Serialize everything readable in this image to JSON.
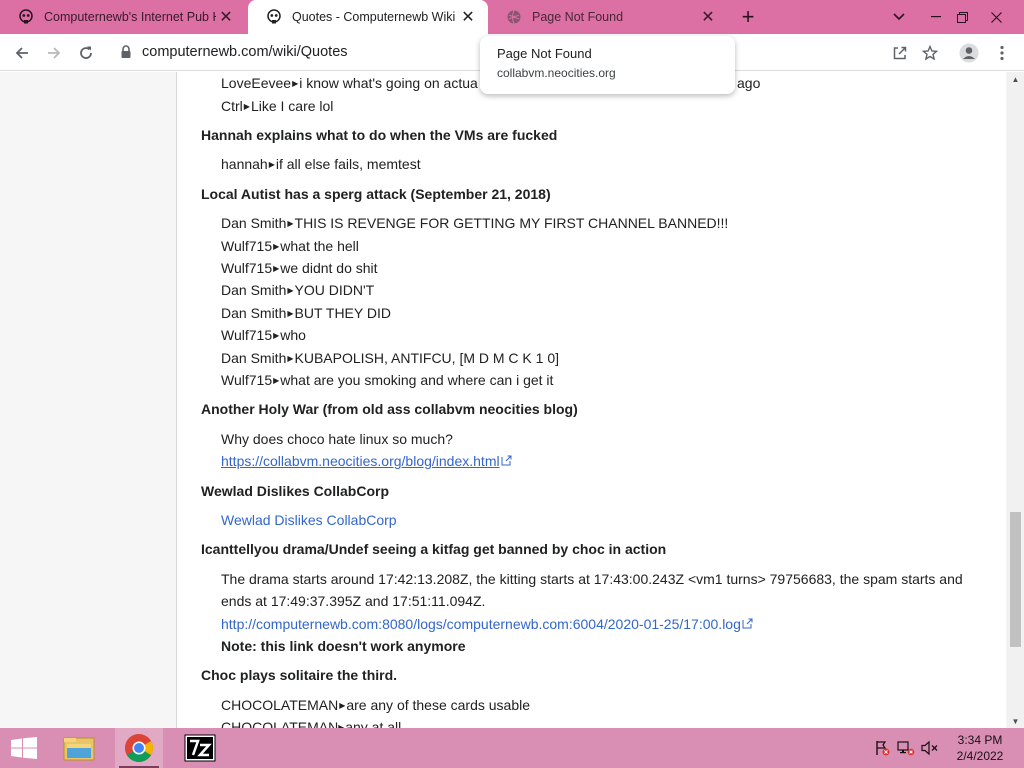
{
  "colors": {
    "tabstrip": "#dc6fa3",
    "taskbar": "#d98fb4",
    "link": "#3366cc"
  },
  "tabs": [
    {
      "title": "Computernewb's Internet Pub H",
      "icon": "skull-icon"
    },
    {
      "title": "Quotes - Computernewb Wiki",
      "icon": "skull-icon",
      "active": true
    },
    {
      "title": "Page Not Found",
      "icon": "globe-icon"
    }
  ],
  "toolbar": {
    "url_host": "computernewb.com",
    "url_path": "/wiki/Quotes"
  },
  "hovercard": {
    "title": "Page Not Found",
    "url": "collabvm.neocities.org"
  },
  "page": {
    "top_cut_user": "LoveEevee",
    "top_cut_text": "i know what's going on actua",
    "top_cut_tail": "ago",
    "ctrl_line": {
      "user": "Ctrl",
      "text": "Like I care lol"
    },
    "sections": {
      "hannah_title": "Hannah explains what to do when the VMs are fucked",
      "hannah_line": {
        "user": "hannah",
        "text": "if all else fails, memtest"
      },
      "autist_title": "Local Autist has a sperg attack (September 21, 2018)",
      "autist_lines": [
        {
          "user": "Dan Smith",
          "text": "THIS IS REVENGE FOR GETTING MY FIRST CHANNEL BANNED!!!"
        },
        {
          "user": "Wulf715",
          "text": "what the hell"
        },
        {
          "user": "Wulf715",
          "text": "we didnt do shit"
        },
        {
          "user": "Dan Smith",
          "text": "YOU DIDN'T"
        },
        {
          "user": "Dan Smith",
          "text": "BUT THEY DID"
        },
        {
          "user": "Wulf715",
          "text": "who"
        },
        {
          "user": "Dan Smith",
          "text": "KUBAPOLISH, ANTIFCU, [M D M C K 1 0]"
        },
        {
          "user": "Wulf715",
          "text": "what are you smoking and where can i get it"
        }
      ],
      "holywar_title": "Another Holy War (from old ass collabvm neocities blog)",
      "holywar_text": "Why does choco hate linux so much?",
      "holywar_link": "https://collabvm.neocities.org/blog/index.html",
      "wewlad_title": "Wewlad Dislikes CollabCorp",
      "wewlad_link": "Wewlad Dislikes CollabCorp",
      "drama_title": "Icanttellyou drama/Undef seeing a kitfag get banned by choc in action",
      "drama_text_1": "The drama starts around 17:42:13.208Z, the kitting starts at 17:43:00.243Z <vm1 turns> 79756683, the spam starts and",
      "drama_text_2": "ends at 17:49:37.395Z and 17:51:11.094Z.",
      "drama_link": "http://computernewb.com:8080/logs/computernewb.com:6004/2020-01-25/17:00.log",
      "drama_note": "Note: this link doesn't work anymore",
      "choc_title": "Choc plays solitaire the third.",
      "choc_line": {
        "user": "CHOCOLATEMAN",
        "text": "are any of these cards usable"
      },
      "choc_cut": "CHOCOLATEMAN▸any at all"
    }
  },
  "taskbar": {
    "apps": [
      "file-explorer-icon",
      "chrome-icon",
      "7zip-icon"
    ],
    "time": "3:34 PM",
    "date": "2/4/2022"
  }
}
